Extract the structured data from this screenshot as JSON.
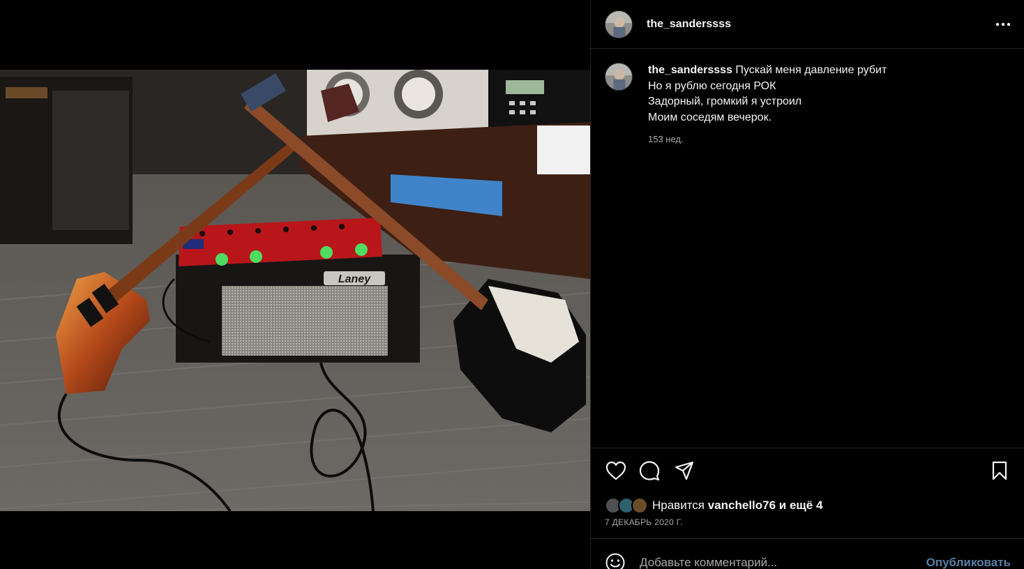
{
  "post": {
    "username": "the_sanderssss",
    "caption_lines": [
      "Пускай меня давление рубит",
      "Но я рублю сегодня РОК",
      "Задорный, громкий я устроил",
      "Моим соседям вечерок."
    ],
    "time_ago": "153 нед.",
    "likes": {
      "prefix": "Нравится ",
      "user": "vanchello76",
      "suffix": " и ещё 4"
    },
    "date": "7 ДЕКАБРЬ 2020 Г."
  },
  "photo": {
    "amp_brand": "Laney"
  },
  "actions": {
    "like_icon": "heart-icon",
    "comment_icon": "comment-icon",
    "share_icon": "share-icon",
    "save_icon": "bookmark-icon",
    "more_icon": "more-icon"
  },
  "comment_box": {
    "placeholder": "Добавьте комментарий...",
    "publish_label": "Опубликовать",
    "emoji_icon": "emoji-icon"
  },
  "colors": {
    "background": "#000000",
    "text": "#f5f5f5",
    "secondary_text": "#a8a8a8",
    "divider": "#262626",
    "publish_disabled": "#5a7fa6"
  }
}
